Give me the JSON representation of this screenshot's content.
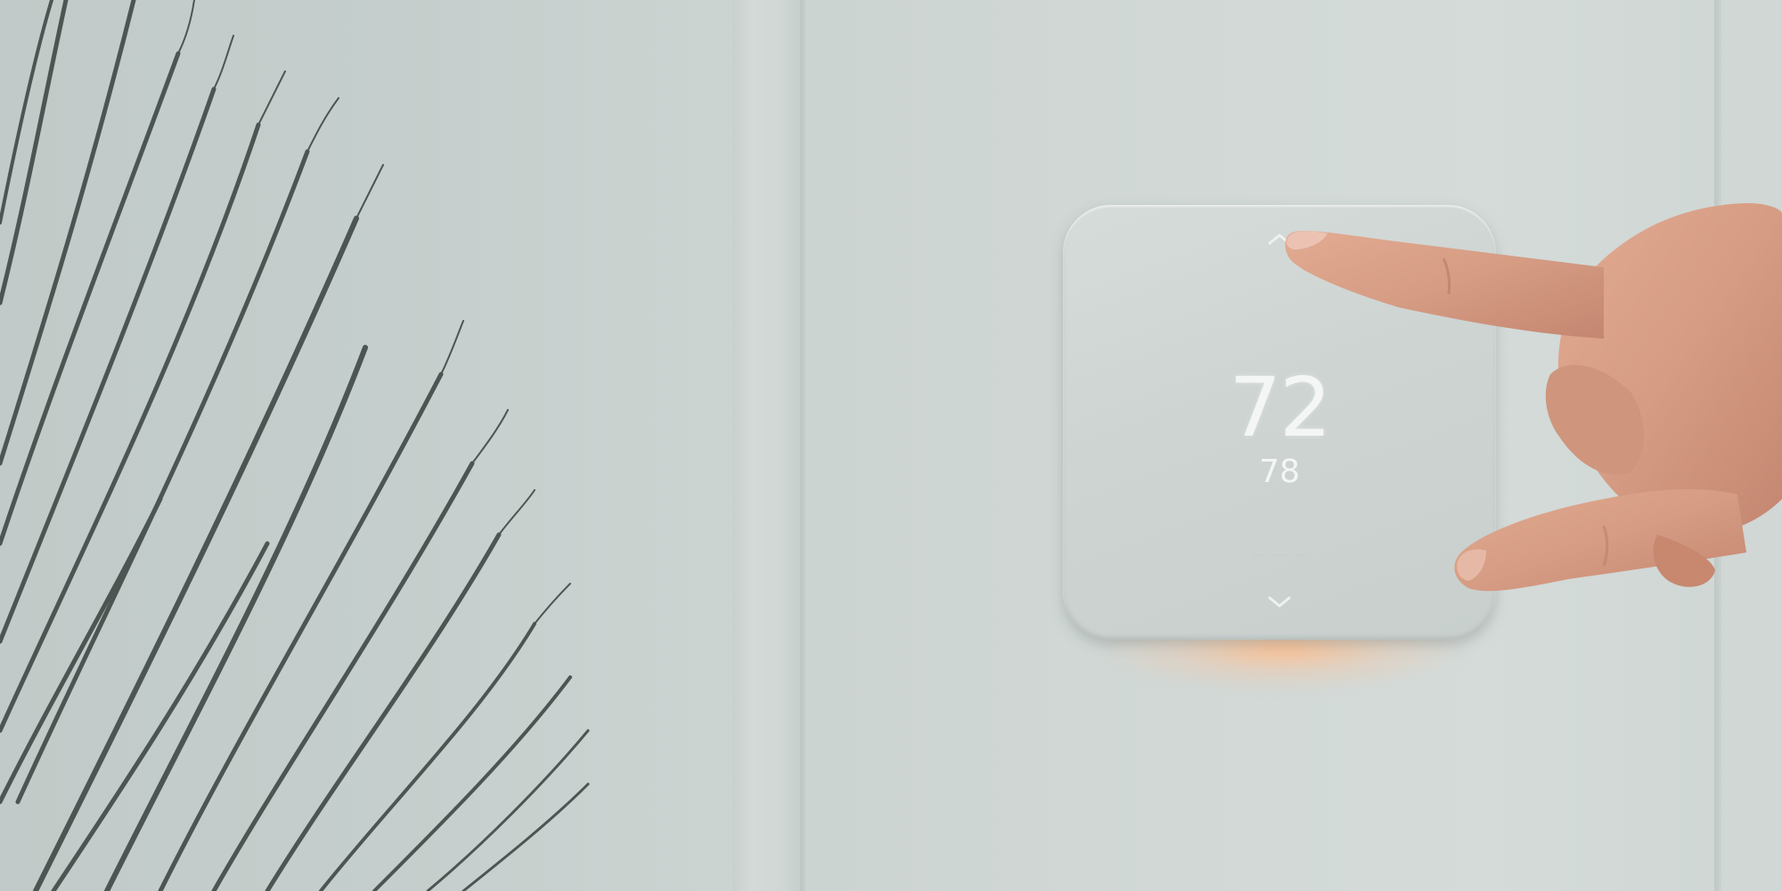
{
  "scene": {
    "subject": "",
    "background": ""
  },
  "thermostat": {
    "current_temperature": "72",
    "target_temperature": "78",
    "up_control_icon": "chevron-up-icon",
    "down_control_icon": "chevron-down-icon",
    "glow_color": "#ffbe8c",
    "body_color": "#d2d8d6"
  },
  "colors": {
    "wall": "#ccd4d2",
    "plant": "#4a5250",
    "skin": "#d9a088"
  }
}
